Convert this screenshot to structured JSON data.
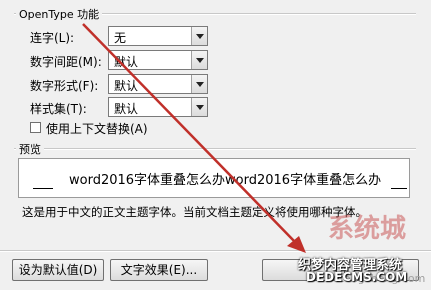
{
  "opentype_section": {
    "title": "OpenType 功能",
    "ligatures": {
      "label": "连字(L):",
      "value": "无"
    },
    "number_spacing": {
      "label": "数字间距(M):",
      "value": "默认"
    },
    "number_forms": {
      "label": "数字形式(F):",
      "value": "默认"
    },
    "stylistic_sets": {
      "label": "样式集(T):",
      "value": "默认"
    },
    "contextual_alternates": {
      "label": "使用上下文替换(A)",
      "checked": false
    }
  },
  "preview_section": {
    "title": "预览",
    "sample_text": "word2016字体重叠怎么办word2016字体重叠怎么办",
    "description": "这是用于中文的正文主题字体。当前文档主题定义将使用哪种字体。"
  },
  "buttons": {
    "set_default": "设为默认值(D)",
    "text_effects": "文字效果(E)..."
  },
  "watermark": {
    "logo_text": "系统城",
    "url_text": "xitongcheng.com",
    "badge_line1": "织梦内容管理系统",
    "badge_line2": "DEDECMS.COM"
  },
  "annotation": {
    "arrow_color": "#c0302a"
  }
}
